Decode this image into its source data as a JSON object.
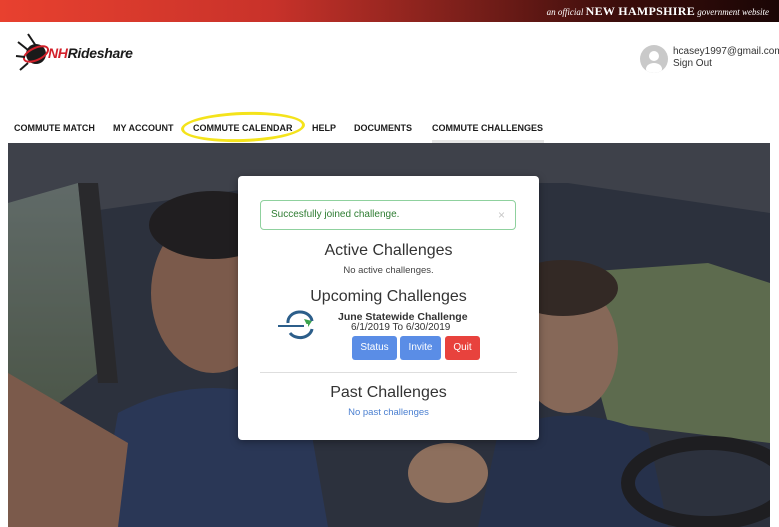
{
  "banner": {
    "prefix": "an official",
    "state": "NEW HAMPSHIRE",
    "suffix": "government website"
  },
  "header": {
    "logo_text_nh": "NH",
    "logo_text_rest": "Rideshare",
    "user_email": "hcasey1997@gmail.com",
    "sign_out": "Sign Out"
  },
  "nav": {
    "items": [
      {
        "label": "COMMUTE MATCH"
      },
      {
        "label": "MY ACCOUNT"
      },
      {
        "label": "COMMUTE CALENDAR"
      },
      {
        "label": "HELP"
      },
      {
        "label": "DOCUMENTS"
      },
      {
        "label": "COMMUTE CHALLENGES"
      }
    ],
    "active": "COMMUTE CHALLENGES"
  },
  "modal": {
    "alert_text": "Succesfully joined challenge.",
    "alert_close": "×",
    "active_heading": "Active Challenges",
    "active_empty": "No active challenges.",
    "upcoming_heading": "Upcoming Challenges",
    "challenge": {
      "name": "June Statewide Challenge",
      "dates": "6/1/2019 To 6/30/2019",
      "status_btn": "Status",
      "invite_btn": "Invite",
      "quit_btn": "Quit"
    },
    "past_heading": "Past Challenges",
    "past_empty": "No past challenges"
  },
  "colors": {
    "primary_button": "#5a8de6",
    "danger_button": "#e8423d",
    "alert_border": "#8fd19e",
    "highlight": "#f4e31b",
    "brand_red": "#d3202a"
  }
}
